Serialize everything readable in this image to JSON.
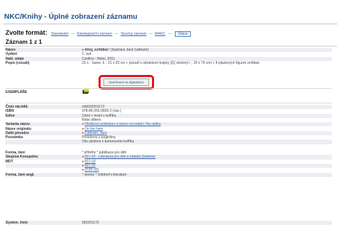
{
  "title": "NKC/Knihy - Úplné zobrazení záznamu",
  "formats": {
    "lead": "Zvolte formát:",
    "items": [
      "Standardní",
      "Katalogizační záznam",
      "Stručný záznam",
      "MARC"
    ],
    "separator": "—",
    "cite_button": "Citace"
  },
  "record_count": "Záznam 1 z 1",
  "fields": {
    "nazev": {
      "label": "Název",
      "title": "Ahoj, zvířátka!",
      "rest": " / [ilustrace Jack Cattnam]"
    },
    "vydani": {
      "label": "Vydání",
      "value": "1. vyd."
    },
    "nakl": {
      "label": "Nakl. údaje",
      "value": "Čestlice : Rebo, 2011"
    },
    "popis": {
      "label": "Popis (rozsah)",
      "value": "23 s. : barev. il. ; 21 x 26 cm + pozadí s obrázkom krajiny ([1] složený l. ; 20 x 75 cm) + 8 plastových figurek zvířátek"
    },
    "digi_button": "Navrhnout na digitalizaci",
    "exemplare": {
      "label": "EXEMPLÁŘE"
    },
    "cislo": {
      "label": "Číslo nár.bibl.",
      "value": "cnb002201172"
    },
    "isbn": {
      "label": "ISBN",
      "value": "978-80-255-0835-3 (váz.)"
    },
    "edice": {
      "label": "Edice",
      "value": "Čtení + hraní v kufříku"
    },
    "edice2": {
      "value": "Rebo dětem"
    },
    "varianta": {
      "label": "Varianta názvu",
      "value": "Obálkový podnázev a název na krabici: Na statku"
    },
    "originalu": {
      "label": "Název originálu",
      "value": "On the farm"
    },
    "puvodce": {
      "label": "Další původce",
      "value": "Cattnam, Jack"
    },
    "poznamka": {
      "label": "Poznámka",
      "value": "Přeloženo z angličtiny"
    },
    "poznamka2": {
      "value": "Vše uloženo v kartonovém kufříku"
    },
    "forma": {
      "label": "Forma, žánr",
      "value": "* příběhy * publikace pro děti"
    },
    "skupina": {
      "label": "Skupina Konspektu",
      "value": "821-93 - Literatura pro děti a mládež (beletrie)"
    },
    "mdt": {
      "label": "MDT",
      "values": [
        "821-93",
        "821-32",
        "(0.82-32)"
      ]
    },
    "forma_angl": {
      "label": "Forma, žánr-angl.",
      "value": "* stories * children's literature"
    },
    "system": {
      "label": "Systém. číslo",
      "value": "002201172"
    }
  },
  "colors": {
    "title": "#1f4e8c",
    "link": "#3b63a8",
    "highlight": "#e01212"
  }
}
